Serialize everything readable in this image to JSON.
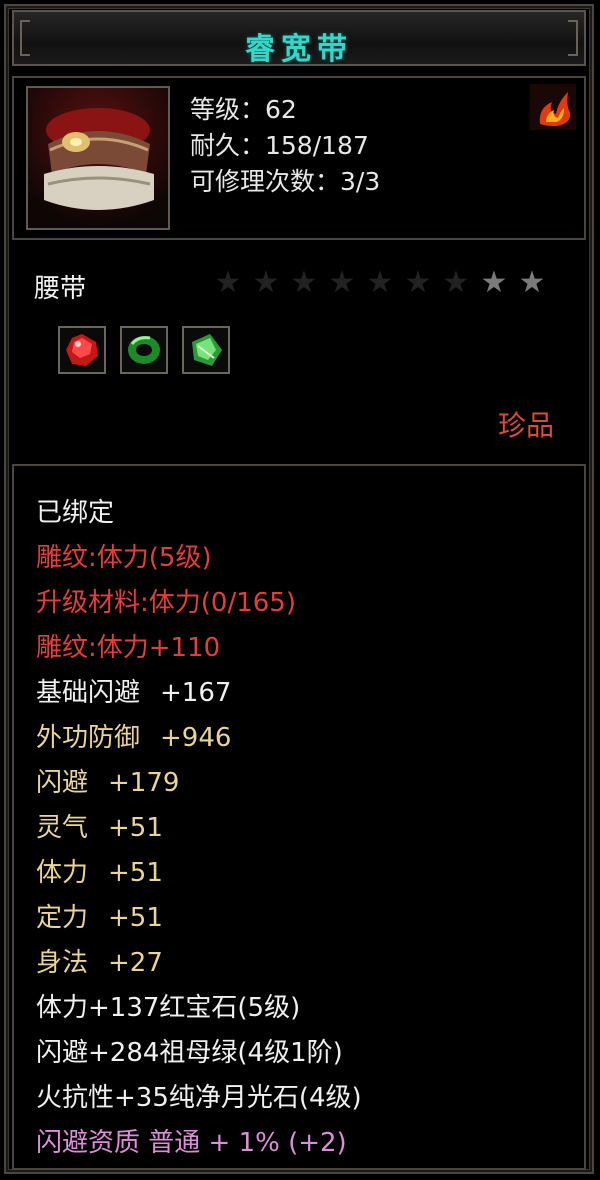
{
  "item": {
    "name": "睿宽带",
    "stats": [
      {
        "label": "等级：62"
      },
      {
        "label": "耐久：158/187"
      },
      {
        "label": "可修理次数：3/3"
      }
    ],
    "type": "腰带",
    "stars": {
      "total": 9,
      "lit": 2
    },
    "gems": [
      {
        "icon": "ruby-gem-icon",
        "color": "#d42020"
      },
      {
        "icon": "jade-ring-icon",
        "color": "#2fae3b"
      },
      {
        "icon": "green-crystal-icon",
        "color": "#5bd05a"
      }
    ],
    "rarity": "珍品"
  },
  "attributes": [
    {
      "text": "已绑定",
      "value": "",
      "color": "white"
    },
    {
      "text": "雕纹:体力(5级)",
      "value": "",
      "color": "red"
    },
    {
      "text": "升级材料:体力(0/165)",
      "value": "",
      "color": "red"
    },
    {
      "text": "雕纹:体力+110",
      "value": "",
      "color": "red"
    },
    {
      "text": "基础闪避",
      "value": "+167",
      "color": "white"
    },
    {
      "text": "外功防御",
      "value": "+946",
      "color": "gold"
    },
    {
      "text": "闪避",
      "value": "+179",
      "color": "gold"
    },
    {
      "text": "灵气",
      "value": "+51",
      "color": "gold"
    },
    {
      "text": "体力",
      "value": "+51",
      "color": "gold"
    },
    {
      "text": "定力",
      "value": "+51",
      "color": "gold"
    },
    {
      "text": "身法",
      "value": "+27",
      "color": "gold"
    },
    {
      "text": "体力+137红宝石(5级)",
      "value": "",
      "color": "white"
    },
    {
      "text": "闪避+284祖母绿(4级1阶)",
      "value": "",
      "color": "white"
    },
    {
      "text": "火抗性+35纯净月光石(4级)",
      "value": "",
      "color": "white"
    },
    {
      "text": "闪避资质  普通  +  1%  (+2)",
      "value": "",
      "color": "pink"
    }
  ]
}
